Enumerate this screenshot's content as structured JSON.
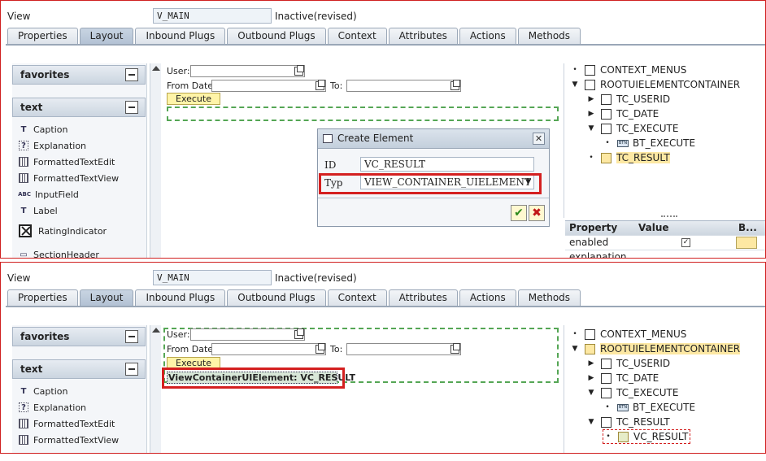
{
  "app": {
    "view_label": "View",
    "view_name": "V_MAIN",
    "view_status": "Inactive(revised)"
  },
  "tabs": [
    {
      "label": "Properties",
      "active": false
    },
    {
      "label": "Layout",
      "active": true
    },
    {
      "label": "Inbound Plugs",
      "active": false
    },
    {
      "label": "Outbound Plugs",
      "active": false
    },
    {
      "label": "Context",
      "active": false
    },
    {
      "label": "Attributes",
      "active": false
    },
    {
      "label": "Actions",
      "active": false
    },
    {
      "label": "Methods",
      "active": false
    }
  ],
  "palette": {
    "favorites_label": "favorites",
    "text_label": "text",
    "items": [
      {
        "label": "Caption",
        "icon": "caption-icon"
      },
      {
        "label": "Explanation",
        "icon": "explanation-icon"
      },
      {
        "label": "FormattedTextEdit",
        "icon": "formatted-text-edit-icon"
      },
      {
        "label": "FormattedTextView",
        "icon": "formatted-text-view-icon"
      },
      {
        "label": "InputField",
        "icon": "input-field-icon"
      },
      {
        "label": "Label",
        "icon": "label-icon"
      },
      {
        "label": "RatingIndicator",
        "icon": "rating-indicator-icon"
      },
      {
        "label": "SectionHeader",
        "icon": "section-header-icon"
      }
    ]
  },
  "form": {
    "user_label": "User:",
    "from_date_label": "From Date:",
    "to_label": "To:",
    "execute_label": "Execute",
    "new_element_label": "ViewContainerUIElement: VC_RESULT"
  },
  "dialog": {
    "title": "Create Element",
    "id_label": "ID",
    "id_value": "VC_RESULT",
    "type_label": "Typ",
    "type_value": "VIEW_CONTAINER_UIELEMENT Vi…",
    "close_glyph": "✕",
    "ok_glyph": "✔",
    "cancel_glyph": "✖"
  },
  "tree_top": [
    {
      "label": "CONTEXT_MENUS",
      "marker": "•"
    },
    {
      "label": "ROOTUIELEMENTCONTAINER",
      "marker": "▼"
    },
    {
      "label": "TC_USERID",
      "marker": "▶"
    },
    {
      "label": "TC_DATE",
      "marker": "▶"
    },
    {
      "label": "TC_EXECUTE",
      "marker": "▼"
    },
    {
      "label": "BT_EXECUTE",
      "marker": "•"
    },
    {
      "label": "TC_RESULT",
      "marker": "•"
    }
  ],
  "tree_bottom": [
    {
      "label": "CONTEXT_MENUS",
      "marker": "•"
    },
    {
      "label": "ROOTUIELEMENTCONTAINER",
      "marker": "▼"
    },
    {
      "label": "TC_USERID",
      "marker": "▶"
    },
    {
      "label": "TC_DATE",
      "marker": "▶"
    },
    {
      "label": "TC_EXECUTE",
      "marker": "▼"
    },
    {
      "label": "BT_EXECUTE",
      "marker": "•"
    },
    {
      "label": "TC_RESULT",
      "marker": "▼"
    },
    {
      "label": "VC_RESULT",
      "marker": "•"
    }
  ],
  "properties": {
    "col_property": "Property",
    "col_value": "Value",
    "col_b": "B...",
    "rows": [
      {
        "name": "enabled",
        "value": "✓"
      },
      {
        "name": "explanation",
        "value": ""
      }
    ]
  },
  "colors": {
    "highlight": "#fde8a3",
    "execute_button": "#fff4a8",
    "drop_area": "#55a655",
    "annotation_red": "#d42020"
  }
}
